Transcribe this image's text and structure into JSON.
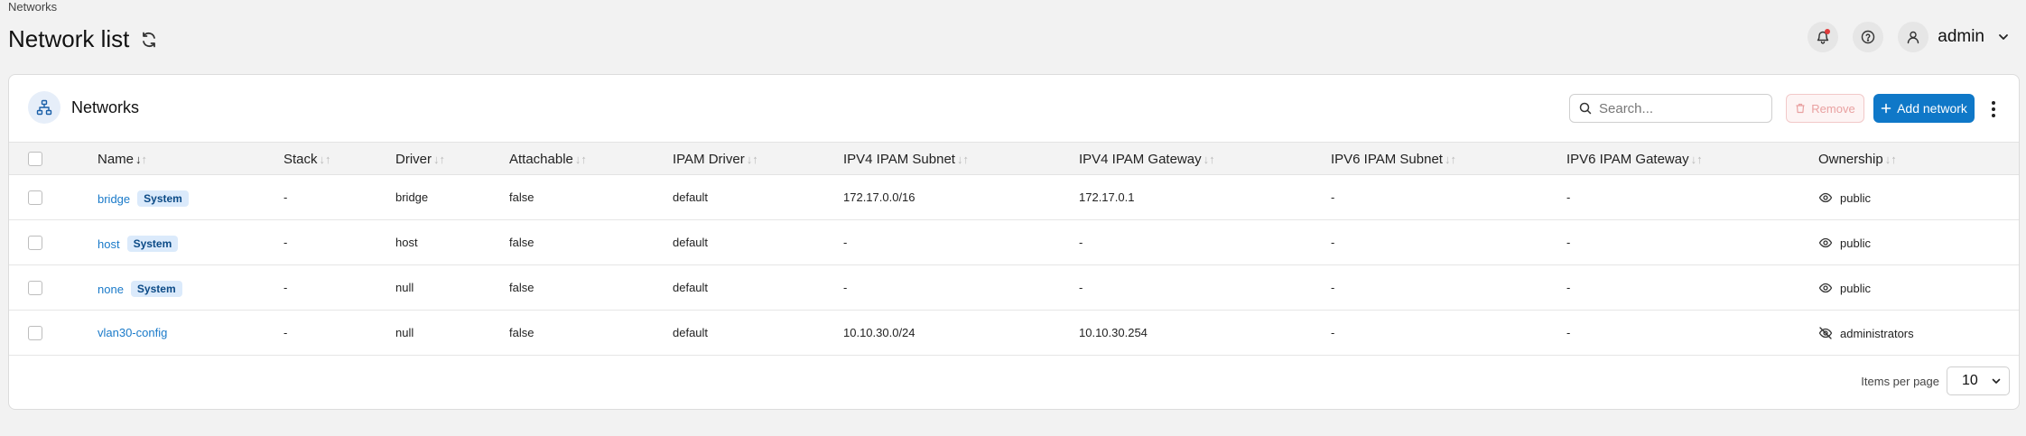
{
  "breadcrumb": "Networks",
  "page_title": "Network list",
  "header": {
    "user_name": "admin",
    "icons": [
      "bell-icon",
      "help-icon",
      "user-icon",
      "chevron-down-icon"
    ]
  },
  "panel": {
    "title": "Networks",
    "icon": "network-icon",
    "search": {
      "placeholder": "Search...",
      "value": ""
    },
    "remove_label": "Remove",
    "add_label": "Add network"
  },
  "columns": [
    "Name",
    "Stack",
    "Driver",
    "Attachable",
    "IPAM Driver",
    "IPV4 IPAM Subnet",
    "IPV4 IPAM Gateway",
    "IPV6 IPAM Subnet",
    "IPV6 IPAM Gateway",
    "Ownership"
  ],
  "rows": [
    {
      "name": "bridge",
      "badge": "System",
      "stack": "-",
      "driver": "bridge",
      "attachable": "false",
      "ipam_driver": "default",
      "ipv4_subnet": "172.17.0.0/16",
      "ipv4_gateway": "172.17.0.1",
      "ipv6_subnet": "-",
      "ipv6_gateway": "-",
      "ownership": "public",
      "ownership_icon": "eye-icon"
    },
    {
      "name": "host",
      "badge": "System",
      "stack": "-",
      "driver": "host",
      "attachable": "false",
      "ipam_driver": "default",
      "ipv4_subnet": "-",
      "ipv4_gateway": "-",
      "ipv6_subnet": "-",
      "ipv6_gateway": "-",
      "ownership": "public",
      "ownership_icon": "eye-icon"
    },
    {
      "name": "none",
      "badge": "System",
      "stack": "-",
      "driver": "null",
      "attachable": "false",
      "ipam_driver": "default",
      "ipv4_subnet": "-",
      "ipv4_gateway": "-",
      "ipv6_subnet": "-",
      "ipv6_gateway": "-",
      "ownership": "public",
      "ownership_icon": "eye-icon"
    },
    {
      "name": "vlan30-config",
      "badge": "",
      "stack": "-",
      "driver": "null",
      "attachable": "false",
      "ipam_driver": "default",
      "ipv4_subnet": "10.10.30.0/24",
      "ipv4_gateway": "10.10.30.254",
      "ipv6_subnet": "-",
      "ipv6_gateway": "-",
      "ownership": "administrators",
      "ownership_icon": "eye-off-icon"
    }
  ],
  "pagination": {
    "items_per_page_label": "Items per page",
    "items_per_page_value": "10"
  },
  "colors": {
    "accent": "#0f78c8",
    "link": "#1a7ac9",
    "badge_bg": "#dbeafb",
    "remove_text": "#e9a1a1"
  }
}
